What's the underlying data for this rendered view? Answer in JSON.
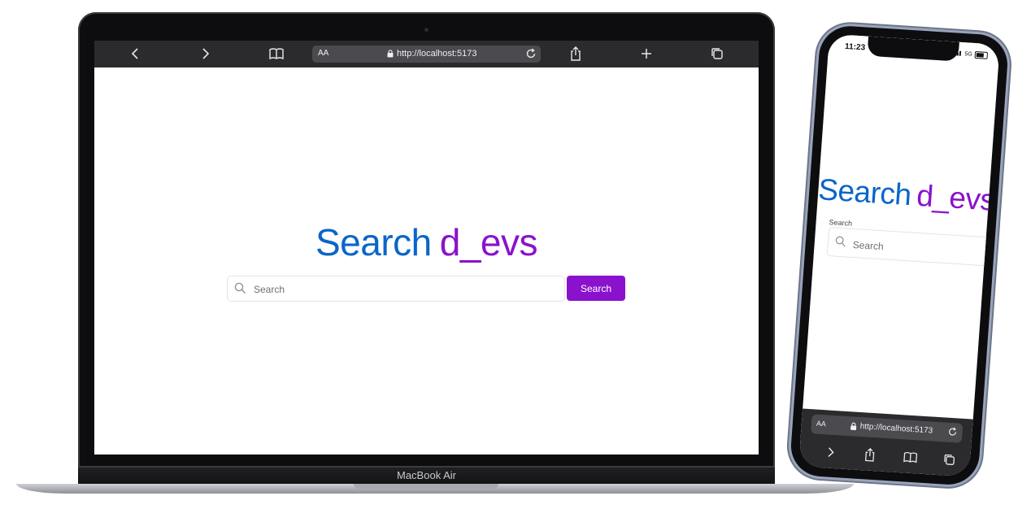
{
  "laptop": {
    "model_label": "MacBook Air",
    "browser": {
      "text_size_label": "AA",
      "url": "http://localhost:5173",
      "icons": [
        "back-icon",
        "forward-icon",
        "bookmarks-icon",
        "lock-icon",
        "reload-icon",
        "share-icon",
        "new-tab-icon",
        "tabs-icon"
      ]
    },
    "page": {
      "logo_part1": "Search",
      "logo_part2": "d_evs",
      "search_placeholder": "Search",
      "search_button_label": "Search"
    }
  },
  "phone": {
    "status_time": "11:23",
    "network_label": "5G",
    "page": {
      "logo_part1": "Search",
      "logo_part2": "d_evs",
      "search_label": "Search",
      "search_placeholder": "Search"
    },
    "browser": {
      "text_size_label": "AA",
      "url": "http://localhost:5173"
    }
  },
  "colors": {
    "brand_blue": "#0a66c8",
    "brand_purple": "#8a12cc",
    "toolbar_dark": "#2b2b2e"
  }
}
